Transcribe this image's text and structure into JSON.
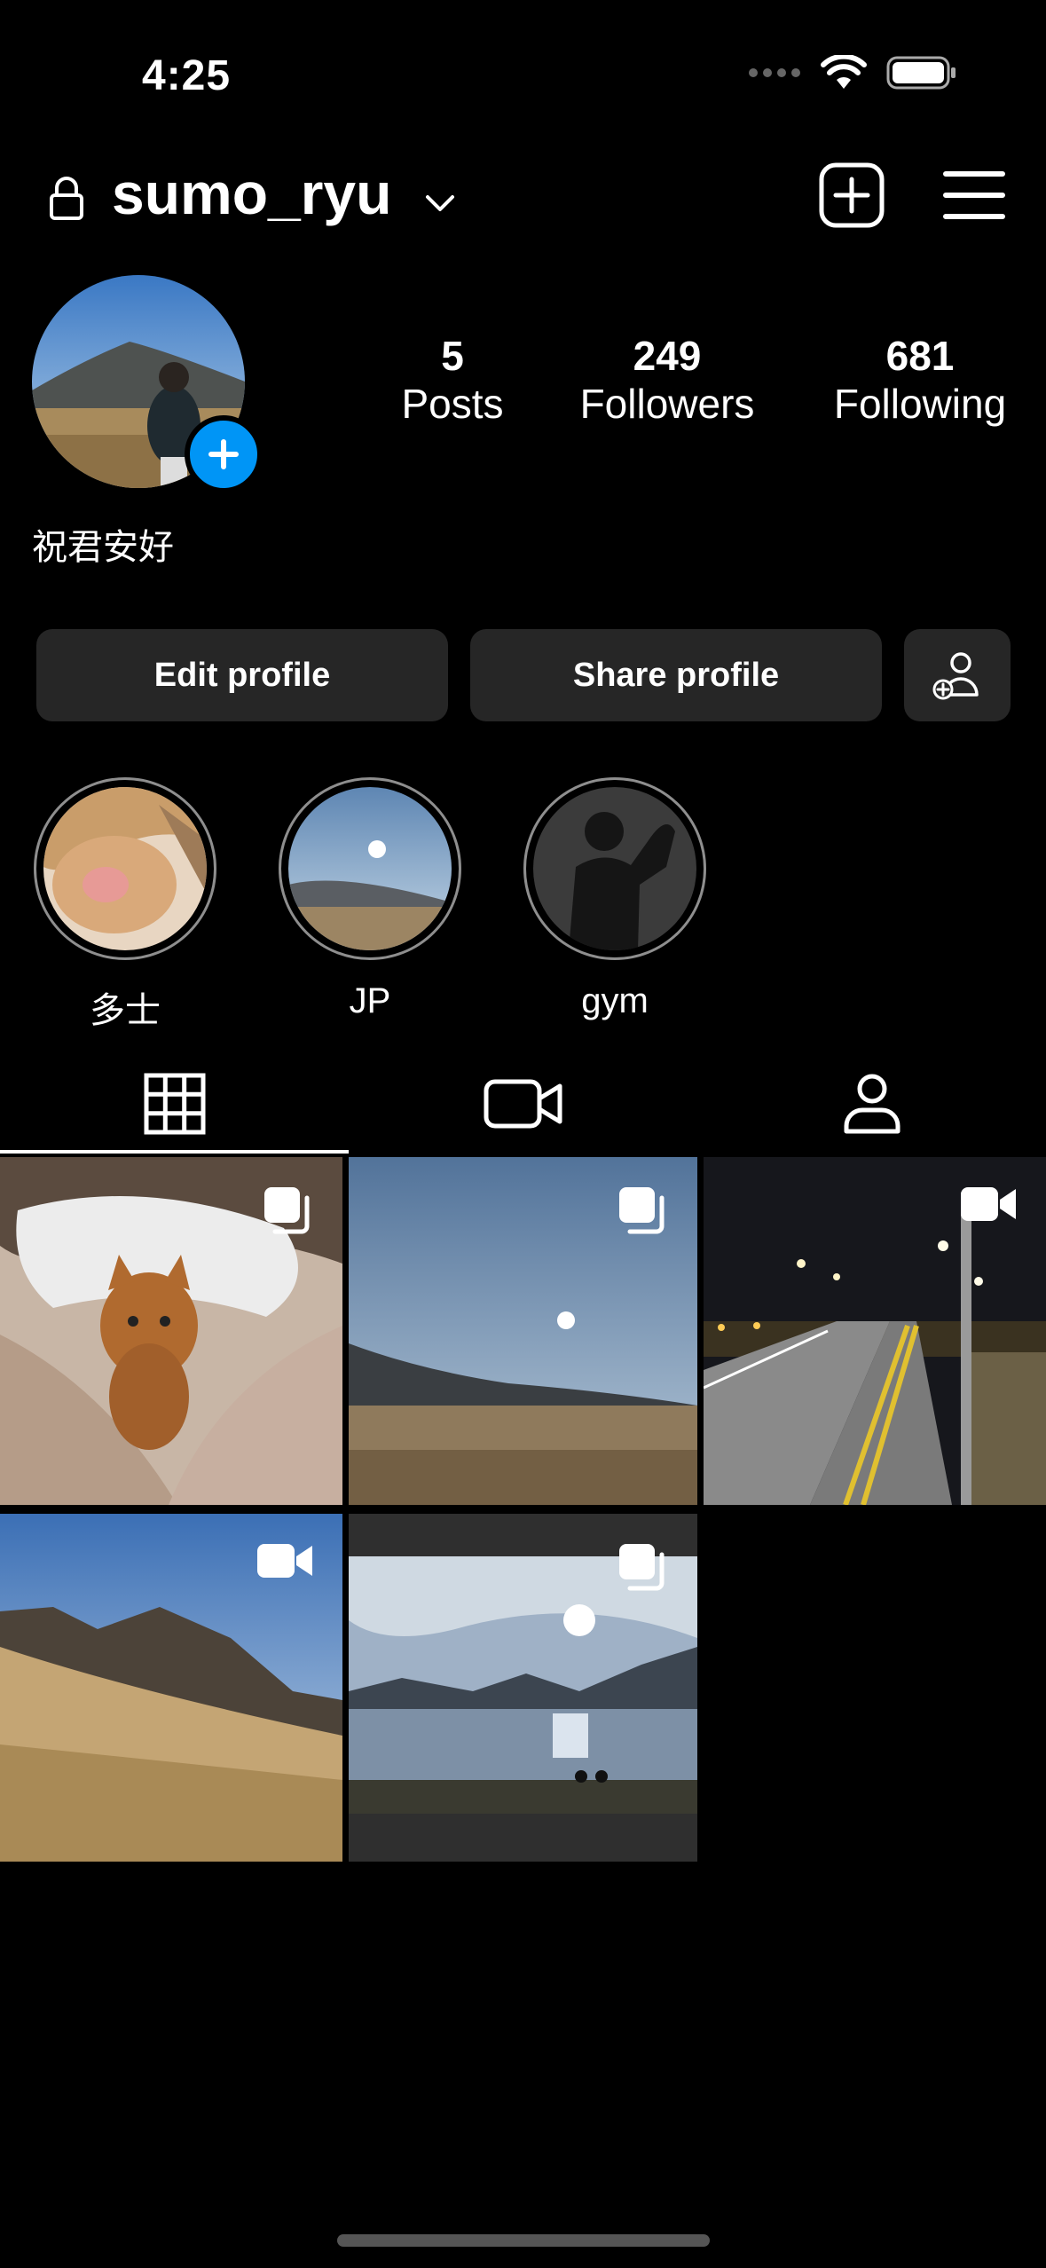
{
  "status_bar": {
    "time": "4:25"
  },
  "header": {
    "username": "sumo_ryu"
  },
  "profile": {
    "stats": [
      {
        "number": "5",
        "label": "Posts"
      },
      {
        "number": "249",
        "label": "Followers"
      },
      {
        "number": "681",
        "label": "Following"
      }
    ],
    "bio": "祝君安好"
  },
  "buttons": {
    "edit": "Edit profile",
    "share": "Share profile"
  },
  "highlights": [
    {
      "label": "多士"
    },
    {
      "label": "JP"
    },
    {
      "label": "gym"
    }
  ],
  "tabs": [
    "grid-icon",
    "reels-icon",
    "tagged-icon"
  ],
  "colors": {
    "accent": "#0095f6",
    "button_bg": "#262626",
    "background": "#000000"
  }
}
